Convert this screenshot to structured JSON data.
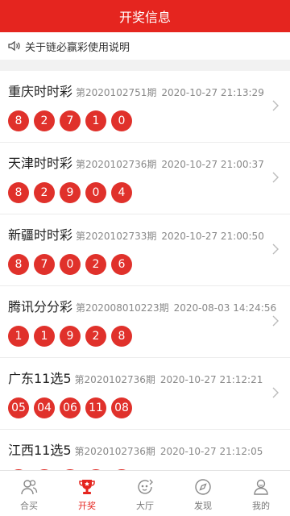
{
  "header": {
    "title": "开奖信息"
  },
  "notice": {
    "text": "关于链必赢彩使用说明",
    "icon": "speaker-icon"
  },
  "lotteries": [
    {
      "name": "重庆时时彩",
      "issue": "第2020102751期",
      "datetime": "2020-10-27 21:13:29",
      "numbers": [
        "8",
        "2",
        "7",
        "1",
        "0"
      ]
    },
    {
      "name": "天津时时彩",
      "issue": "第2020102736期",
      "datetime": "2020-10-27 21:00:37",
      "numbers": [
        "8",
        "2",
        "9",
        "0",
        "4"
      ]
    },
    {
      "name": "新疆时时彩",
      "issue": "第2020102733期",
      "datetime": "2020-10-27 21:00:50",
      "numbers": [
        "8",
        "7",
        "0",
        "2",
        "6"
      ]
    },
    {
      "name": "腾讯分分彩",
      "issue": "第202008010223期",
      "datetime": "2020-08-03 14:24:56",
      "numbers": [
        "1",
        "1",
        "9",
        "2",
        "8"
      ]
    },
    {
      "name": "广东11选5",
      "issue": "第2020102736期",
      "datetime": "2020-10-27 21:12:21",
      "numbers": [
        "05",
        "04",
        "06",
        "11",
        "08"
      ]
    },
    {
      "name": "江西11选5",
      "issue": "第2020102736期",
      "datetime": "2020-10-27 21:12:05",
      "numbers": [
        "",
        "",
        "",
        "",
        ""
      ]
    }
  ],
  "tabbar": {
    "active_color": "#e5251f",
    "items": [
      {
        "label": "合买",
        "icon": "group-buy-icon"
      },
      {
        "label": "开奖",
        "icon": "trophy-icon"
      },
      {
        "label": "大厅",
        "icon": "lobby-icon"
      },
      {
        "label": "发现",
        "icon": "compass-icon"
      },
      {
        "label": "我的",
        "icon": "user-icon"
      }
    ]
  },
  "colors": {
    "brand": "#e5251f",
    "ball": "#e0312b"
  }
}
